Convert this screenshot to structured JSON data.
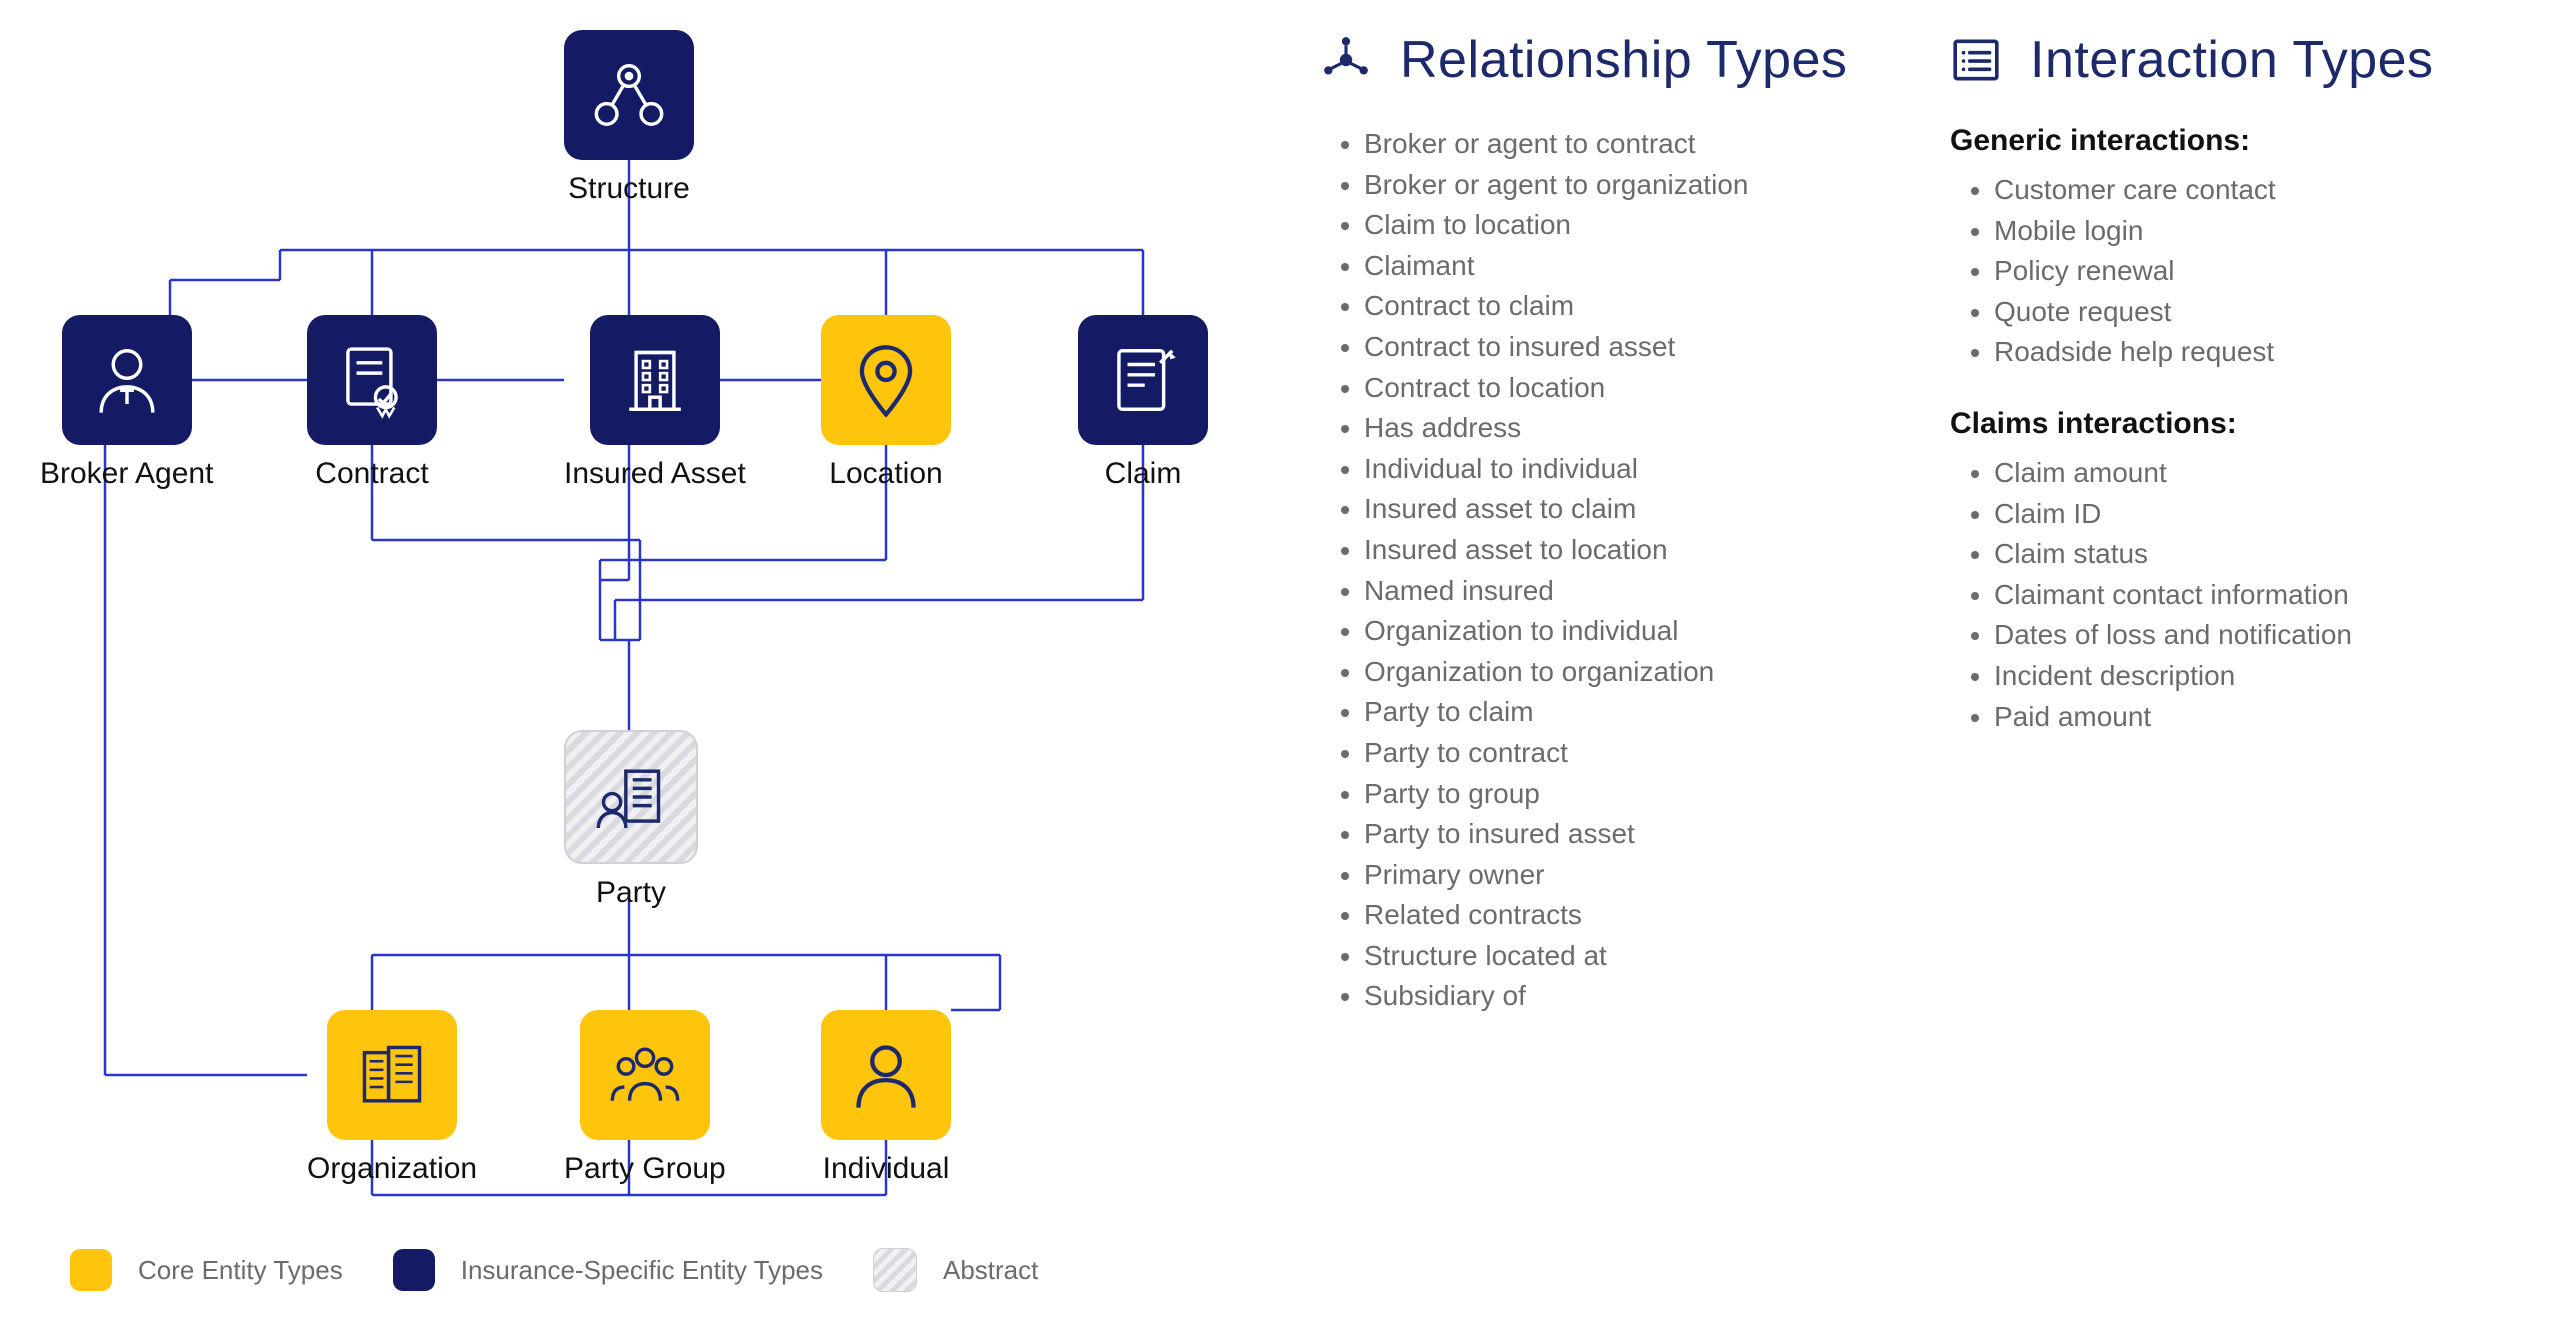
{
  "diagram": {
    "nodes": {
      "structure": {
        "label": "Structure",
        "style": "navy",
        "icon": "structure-icon"
      },
      "broker": {
        "label": "Broker Agent",
        "style": "navy",
        "icon": "broker-icon"
      },
      "contract": {
        "label": "Contract",
        "style": "navy",
        "icon": "contract-icon"
      },
      "asset": {
        "label": "Insured Asset",
        "style": "navy",
        "icon": "building-icon"
      },
      "location": {
        "label": "Location",
        "style": "yellow",
        "icon": "pin-icon"
      },
      "claim": {
        "label": "Claim",
        "style": "navy",
        "icon": "claim-icon"
      },
      "party": {
        "label": "Party",
        "style": "abstract",
        "icon": "party-icon"
      },
      "org": {
        "label": "Organization",
        "style": "yellow",
        "icon": "org-icon"
      },
      "group": {
        "label": "Party Group",
        "style": "yellow",
        "icon": "group-icon"
      },
      "indiv": {
        "label": "Individual",
        "style": "yellow",
        "icon": "person-icon"
      }
    },
    "edges": [
      [
        "structure",
        "contract"
      ],
      [
        "structure",
        "asset"
      ],
      [
        "structure",
        "location"
      ],
      [
        "structure",
        "claim"
      ],
      [
        "structure",
        "broker"
      ],
      [
        "broker",
        "contract"
      ],
      [
        "contract",
        "asset"
      ],
      [
        "asset",
        "location"
      ],
      [
        "broker",
        "org"
      ],
      [
        "contract",
        "party"
      ],
      [
        "asset",
        "party"
      ],
      [
        "location",
        "party"
      ],
      [
        "claim",
        "party"
      ],
      [
        "party",
        "org"
      ],
      [
        "party",
        "group"
      ],
      [
        "party",
        "indiv"
      ],
      [
        "org",
        "group"
      ],
      [
        "group",
        "indiv"
      ],
      [
        "org",
        "indiv"
      ]
    ]
  },
  "relationship": {
    "heading": "Relationship Types",
    "items": [
      "Broker or agent to contract",
      "Broker or agent to organization",
      "Claim to location",
      "Claimant",
      "Contract to claim",
      "Contract to insured asset",
      "Contract to location",
      "Has address",
      "Individual to individual",
      "Insured asset to claim",
      "Insured asset to location",
      "Named insured",
      "Organization to individual",
      "Organization to organization",
      "Party to claim",
      "Party to contract",
      "Party to group",
      "Party to insured asset",
      "Primary owner",
      "Related contracts",
      "Structure located at",
      "Subsidiary of"
    ]
  },
  "interaction": {
    "heading": "Interaction Types",
    "generic": {
      "heading": "Generic interactions:",
      "items": [
        "Customer care contact",
        "Mobile login",
        "Policy renewal",
        "Quote request",
        "Roadside help request"
      ]
    },
    "claims": {
      "heading": "Claims interactions:",
      "items": [
        "Claim amount",
        "Claim ID",
        "Claim status",
        "Claimant contact information",
        "Dates of loss and notification",
        "Incident description",
        "Paid amount"
      ]
    }
  },
  "legend": {
    "core": "Core Entity Types",
    "specific": "Insurance-Specific Entity Types",
    "abstract": "Abstract"
  }
}
